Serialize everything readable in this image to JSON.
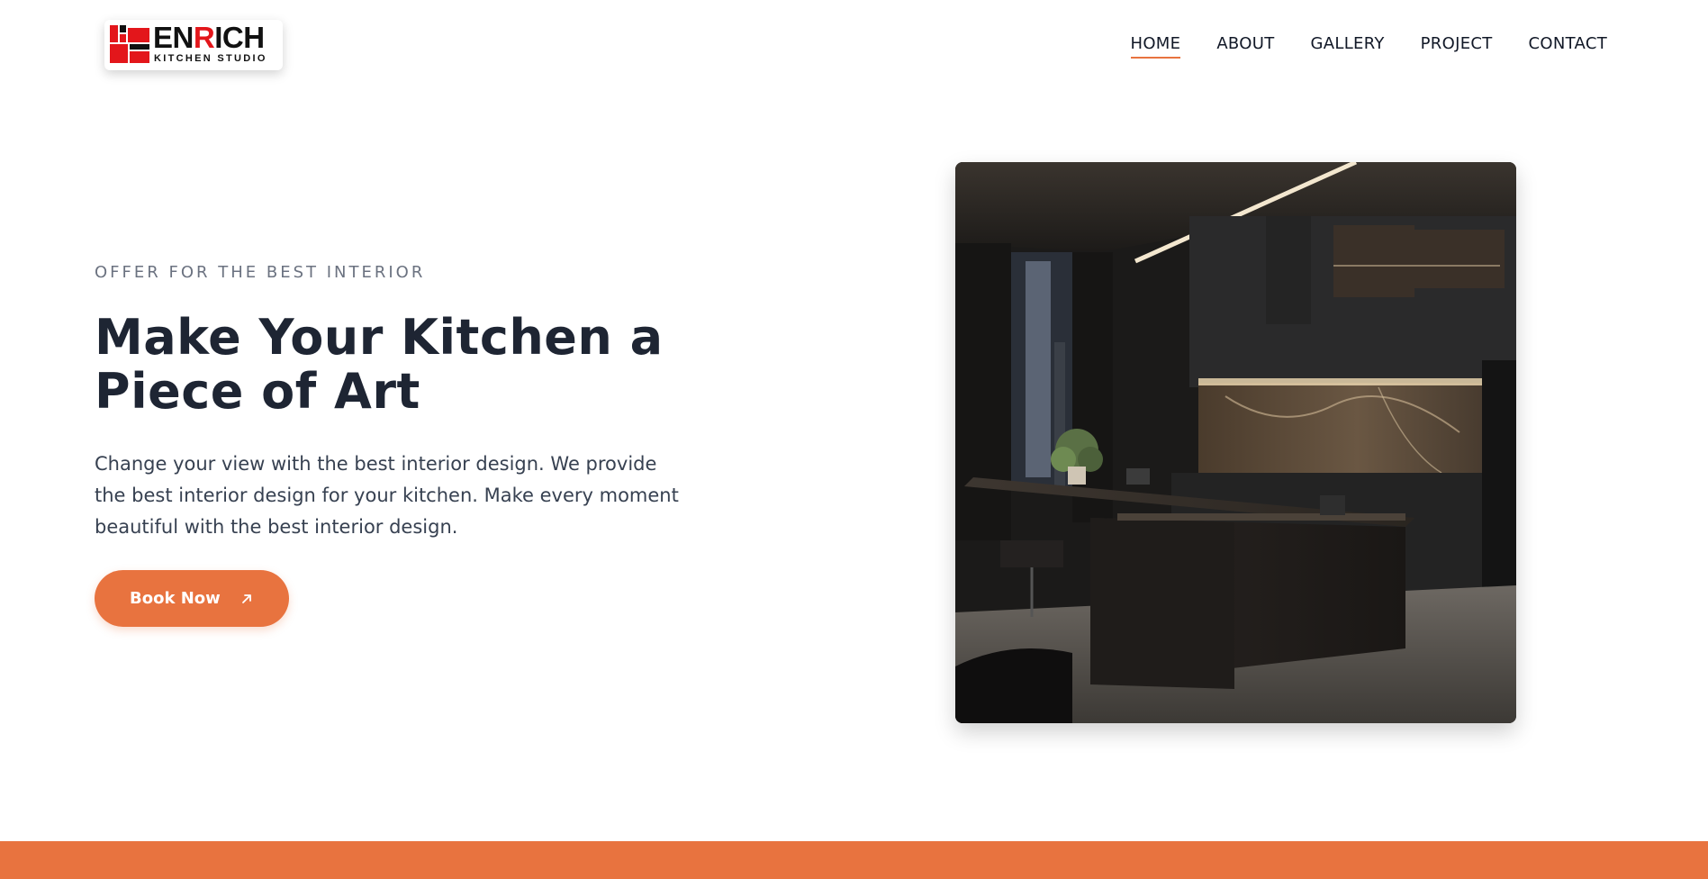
{
  "brand": {
    "logo_main_prefix": "EN",
    "logo_main_accent": "R",
    "logo_main_suffix": "ICH",
    "logo_sub": "KITCHEN STUDIO",
    "red": "#e3161b"
  },
  "nav": {
    "items": [
      {
        "label": "HOME",
        "active": true
      },
      {
        "label": "ABOUT",
        "active": false
      },
      {
        "label": "GALLERY",
        "active": false
      },
      {
        "label": "PROJECT",
        "active": false
      },
      {
        "label": "CONTACT",
        "active": false
      }
    ]
  },
  "hero": {
    "eyebrow": "OFFER FOR THE BEST INTERIOR",
    "title": "Make Your Kitchen a Piece of Art",
    "description": "Change your view with the best interior design. We provide the best interior design for your kitchen. Make every moment beautiful with the best interior design.",
    "cta_label": "Book Now",
    "cta_icon": "arrow-up-right-icon"
  },
  "colors": {
    "accent": "#e8733f",
    "heading": "#1e2533",
    "muted": "#6b7280"
  }
}
